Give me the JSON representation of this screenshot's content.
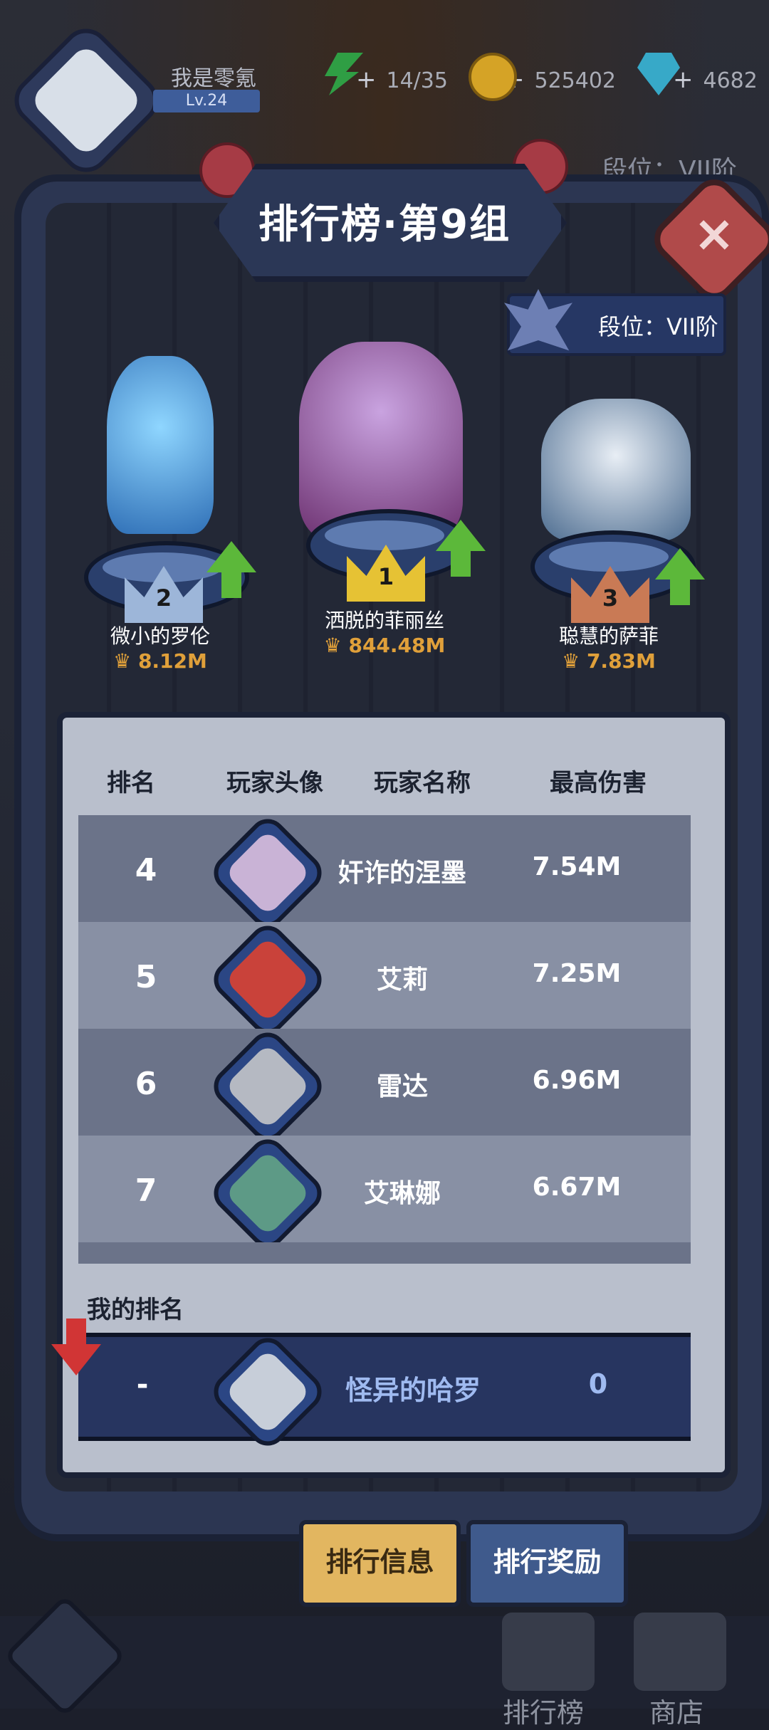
{
  "hud": {
    "player_name": "我是零氪",
    "player_level": "Lv.24",
    "energy": "14/35",
    "coins": "525402",
    "gems": "4682",
    "plus": "+"
  },
  "header": {
    "title": "排行榜·第9组",
    "close": "×",
    "tier_top": "段位：VII阶",
    "tier_badge": "段位：VII阶"
  },
  "podium": [
    {
      "rank": "2",
      "name": "微小的罗伦",
      "damage": "8.12M"
    },
    {
      "rank": "1",
      "name": "洒脱的菲丽丝",
      "damage": "844.48M"
    },
    {
      "rank": "3",
      "name": "聪慧的萨菲",
      "damage": "7.83M"
    }
  ],
  "table": {
    "columns": [
      "排名",
      "玩家头像",
      "玩家名称",
      "最高伤害"
    ],
    "rows": [
      {
        "rank": "4",
        "name": "奸诈的涅墨",
        "damage": "7.54M"
      },
      {
        "rank": "5",
        "name": "艾莉",
        "damage": "7.25M"
      },
      {
        "rank": "6",
        "name": "雷达",
        "damage": "6.96M"
      },
      {
        "rank": "7",
        "name": "艾琳娜",
        "damage": "6.67M"
      }
    ]
  },
  "my_rank": {
    "label": "我的排名",
    "rank": "-",
    "name": "怪异的哈罗",
    "damage": "0"
  },
  "tabs": {
    "info": "排行信息",
    "rewards": "排行奖励"
  },
  "bottom_nav": {
    "leaderboard": "排行榜",
    "shop": "商店"
  },
  "colors": {
    "gold": "#e2b660",
    "tab_blue": "#3f5a8c",
    "damage_orange": "#e0a03a",
    "up_green": "#5cb83a",
    "down_red": "#d13535"
  }
}
